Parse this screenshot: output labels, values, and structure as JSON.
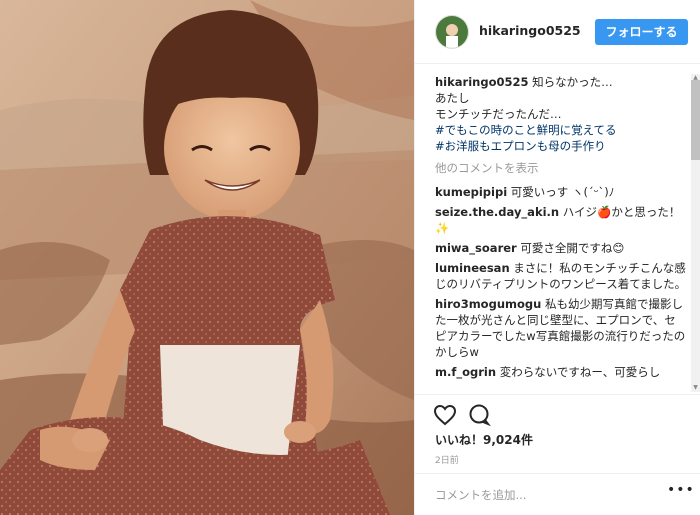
{
  "header": {
    "username": "hikaringo0525",
    "follow_label": "フォローする"
  },
  "caption": {
    "username": "hikaringo0525",
    "lines": [
      "知らなかった…",
      "あたし",
      "モンチッチだったんだ…"
    ],
    "hashtags": [
      "#でもこの時のこと鮮明に覚えてる",
      "#お洋服もエプロンも母の手作り"
    ]
  },
  "more_comments": "他のコメントを表示",
  "comments": [
    {
      "user": "kumepipipi",
      "text": "可愛いっす ヽ(ˊᵕˋ)ﾉ"
    },
    {
      "user": "seize.the.day_aki.n",
      "text": "ハイジ🍎かと思った！✨"
    },
    {
      "user": "miwa_soarer",
      "text": "可愛さ全開ですね😊"
    },
    {
      "user": "lumineesan",
      "text": "まさに！私のモンチッチこんな感じのリバティプリントのワンピース着てました。"
    },
    {
      "user": "hiro3mogumogu",
      "text": "私も幼少期写真館で撮影した一枚が光さんと同じ壁型に、エプロンで、セピアカラーでしたw写真館撮影の流行りだったのかしらw"
    },
    {
      "user": "m.f_ogrin",
      "text": "変わらないですねー、可愛らし"
    }
  ],
  "likes": "いいね！9,024件",
  "time_ago": "2日前",
  "add_comment_placeholder": "コメントを追加...",
  "colors": {
    "follow_button": "#3897f0",
    "hashtag": "#003569",
    "border": "#efefef"
  },
  "icons": {
    "like": "heart-icon",
    "comment": "comment-bubble-icon",
    "options": "more-options-icon"
  }
}
